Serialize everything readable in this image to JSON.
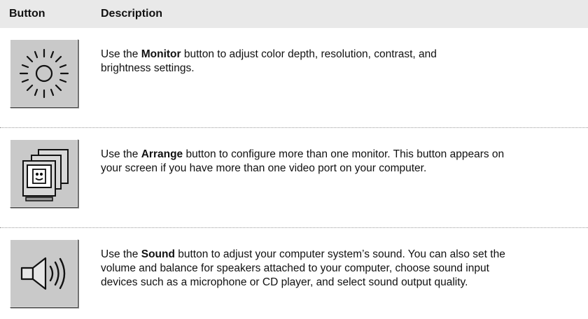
{
  "table": {
    "header": {
      "button": "Button",
      "description": "Description"
    },
    "rows": [
      {
        "icon": "monitor-sun-icon",
        "lines": [
          {
            "pre": "Use the ",
            "bold": "Monitor",
            "post": " button to adjust color depth, resolution, contrast, and"
          },
          {
            "text": "brightness settings."
          }
        ]
      },
      {
        "icon": "arrange-monitors-icon",
        "lines": [
          {
            "pre": "Use the ",
            "bold": "Arrange",
            "post": " button to configure more than one monitor. This button appears on"
          },
          {
            "text": "your screen if you have more than one video port on your computer."
          }
        ]
      },
      {
        "icon": "speaker-sound-icon",
        "lines": [
          {
            "pre": "Use the ",
            "bold": "Sound",
            "post": " button to adjust your computer system’s sound. You can also set the"
          },
          {
            "text": "volume and balance for speakers attached to your computer, choose sound input"
          },
          {
            "text": "devices such as a microphone or CD player, and select sound output quality."
          }
        ]
      }
    ]
  }
}
